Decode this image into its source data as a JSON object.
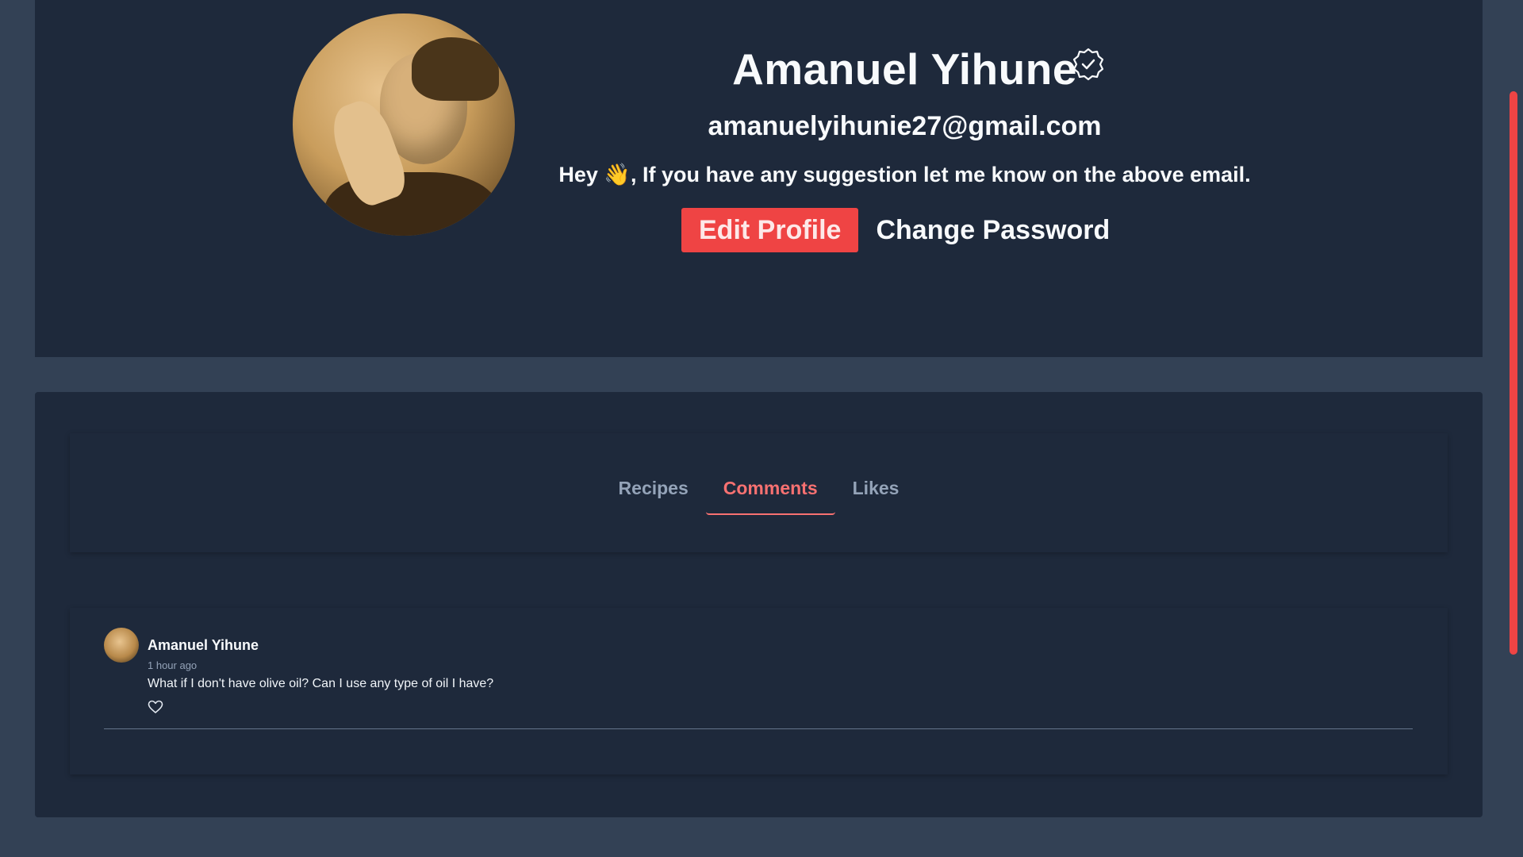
{
  "profile": {
    "name": "Amanuel Yihune",
    "email": "amanuelyihunie27@gmail.com",
    "bio": "Hey 👋, If you have any suggestion let me know on the above email.",
    "edit_label": "Edit Profile",
    "change_password_label": "Change Password",
    "verified_icon": "verified-badge-icon",
    "camera_icon": "camera-icon"
  },
  "tabs": [
    {
      "label": "Recipes",
      "active": false
    },
    {
      "label": "Comments",
      "active": true
    },
    {
      "label": "Likes",
      "active": false
    }
  ],
  "comments": [
    {
      "author": "Amanuel Yihune",
      "time": "1 hour ago",
      "text": "What if I don't have olive oil? Can I use any type of oil I have?",
      "like_icon": "heart-icon"
    }
  ],
  "colors": {
    "accent": "#ef4444",
    "card": "#1e293b",
    "background": "#334155"
  }
}
